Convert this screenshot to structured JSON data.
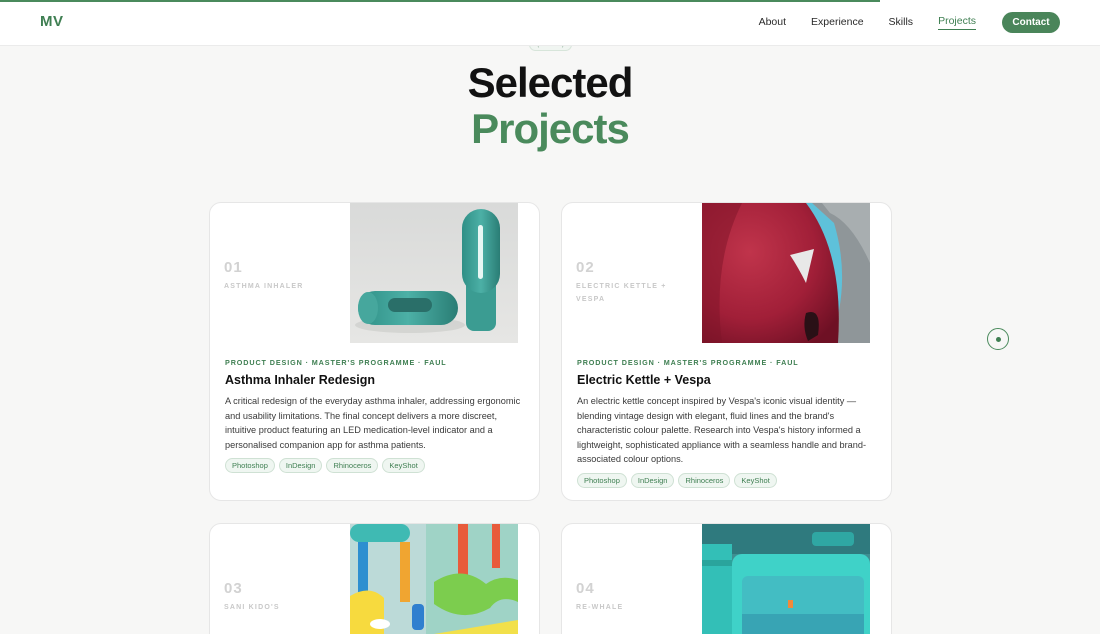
{
  "nav": {
    "logo": "MV",
    "links": [
      "About",
      "Experience",
      "Skills",
      "Projects"
    ],
    "active": "Projects",
    "contact": "Contact",
    "scroll_progress": 0.8
  },
  "section_label": "(? • Work)",
  "heading": {
    "line1": "Selected",
    "line2": "Projects"
  },
  "projects": [
    {
      "num": "01",
      "short": "Asthma Inhaler",
      "meta": "PRODUCT DESIGN · MASTER'S PROGRAMME · FAUL",
      "title": "Asthma Inhaler Redesign",
      "desc": "A critical redesign of the everyday asthma inhaler, addressing ergonomic and usability limitations. The final concept delivers a more discreet, intuitive product featuring an LED medication-level indicator and a personalised companion app for asthma patients.",
      "tags": [
        "Photoshop",
        "InDesign",
        "Rhinoceros",
        "KeyShot"
      ]
    },
    {
      "num": "02",
      "short": "Electric Kettle + Vespa",
      "meta": "PRODUCT DESIGN · MASTER'S PROGRAMME · FAUL",
      "title": "Electric Kettle + Vespa",
      "desc": "An electric kettle concept inspired by Vespa's iconic visual identity — blending vintage design with elegant, fluid lines and the brand's characteristic colour palette. Research into Vespa's history informed a lightweight, sophisticated appliance with a seamless handle and brand-associated colour options.",
      "tags": [
        "Photoshop",
        "InDesign",
        "Rhinoceros",
        "KeyShot"
      ]
    },
    {
      "num": "03",
      "short": "Sani Kido's"
    },
    {
      "num": "04",
      "short": "Re-Whale"
    }
  ]
}
